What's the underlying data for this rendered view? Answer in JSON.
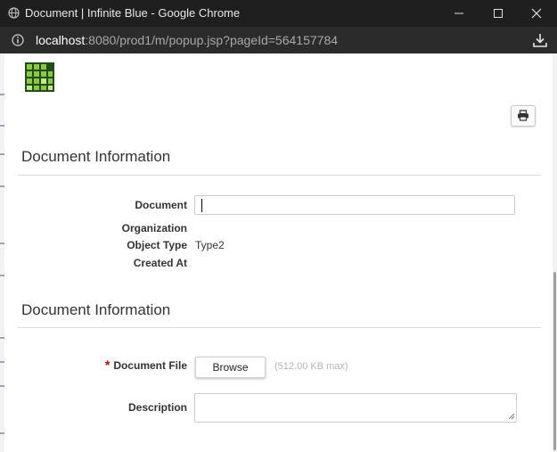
{
  "window": {
    "title": "Document | Infinite Blue - Google Chrome",
    "url_host": "localhost",
    "url_path": ":8080/prod1/m/popup.jsp?pageId=564157784"
  },
  "icons": {
    "site": "globe-icon",
    "minimize": "minimize-icon",
    "maximize": "maximize-icon",
    "close": "close-icon",
    "site_info": "info-icon",
    "download": "download-icon",
    "print": "printer-icon",
    "resize": "resize-grip-icon"
  },
  "colors": {
    "titlebar_bg": "#1f1f1f",
    "addressbar_bg": "#2b2b2b",
    "logo_dark": "#1e4d1e",
    "logo_green": "#8ec63f",
    "required": "#c00000"
  },
  "sections": [
    {
      "title": "Document Information",
      "fields": [
        {
          "label": "Document",
          "value": ""
        },
        {
          "label": "Organization",
          "value": ""
        },
        {
          "label": "Object Type",
          "value": "Type2"
        },
        {
          "label": "Created At",
          "value": ""
        }
      ]
    },
    {
      "title": "Document Information",
      "fields": [
        {
          "label": "Document File",
          "required_mark": "*",
          "button": "Browse",
          "hint": "(512.00 KB max)"
        },
        {
          "label": "Description",
          "value": ""
        }
      ]
    }
  ]
}
